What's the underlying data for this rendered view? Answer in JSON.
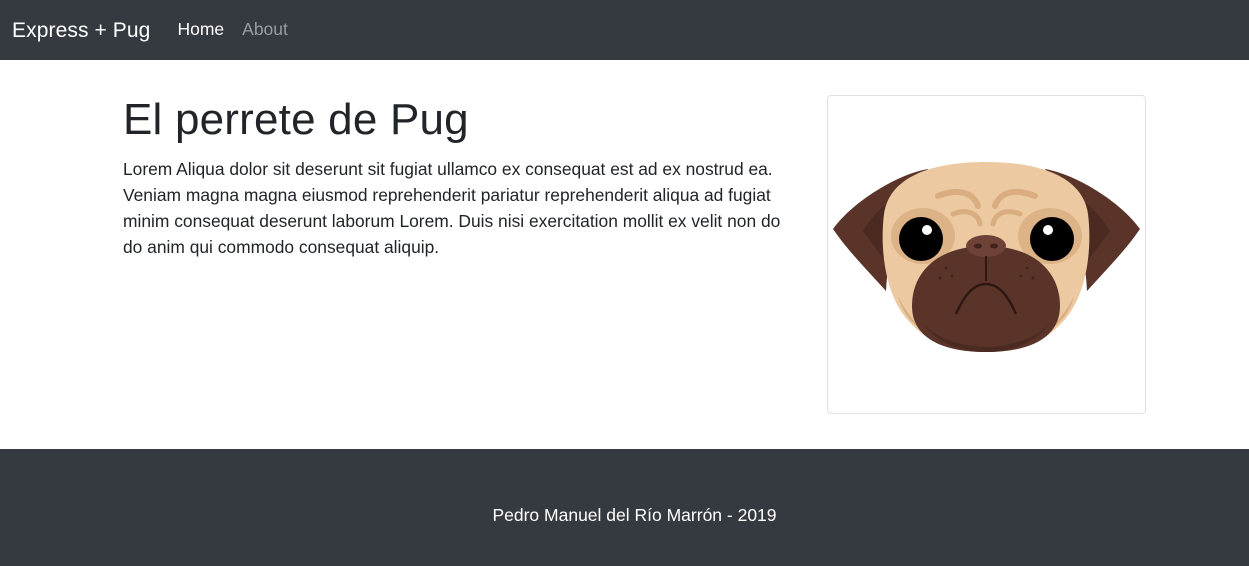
{
  "navbar": {
    "brand": "Express + Pug",
    "links": [
      {
        "label": "Home",
        "active": true
      },
      {
        "label": "About",
        "active": false
      }
    ]
  },
  "main": {
    "title": "El perrete de Pug",
    "paragraph": "Lorem Aliqua dolor sit deserunt sit fugiat ullamco ex consequat est ad ex nostrud ea. Veniam magna magna eiusmod reprehenderit pariatur reprehenderit aliqua ad fugiat minim consequat deserunt laborum Lorem. Duis nisi exercitation mollit ex velit non do do anim qui commodo consequat aliquip.",
    "image_icon": "pug-face-icon"
  },
  "footer": {
    "text": "Pedro Manuel del Río Marrón - 2019"
  },
  "colors": {
    "navbar_bg": "#343a40",
    "footer_bg": "#343a40",
    "text": "#212529",
    "muted_link": "#9a9da0",
    "pug_fur": "#ecc9a0",
    "pug_ears": "#5a3429",
    "pug_muzzle": "#5a3429"
  }
}
